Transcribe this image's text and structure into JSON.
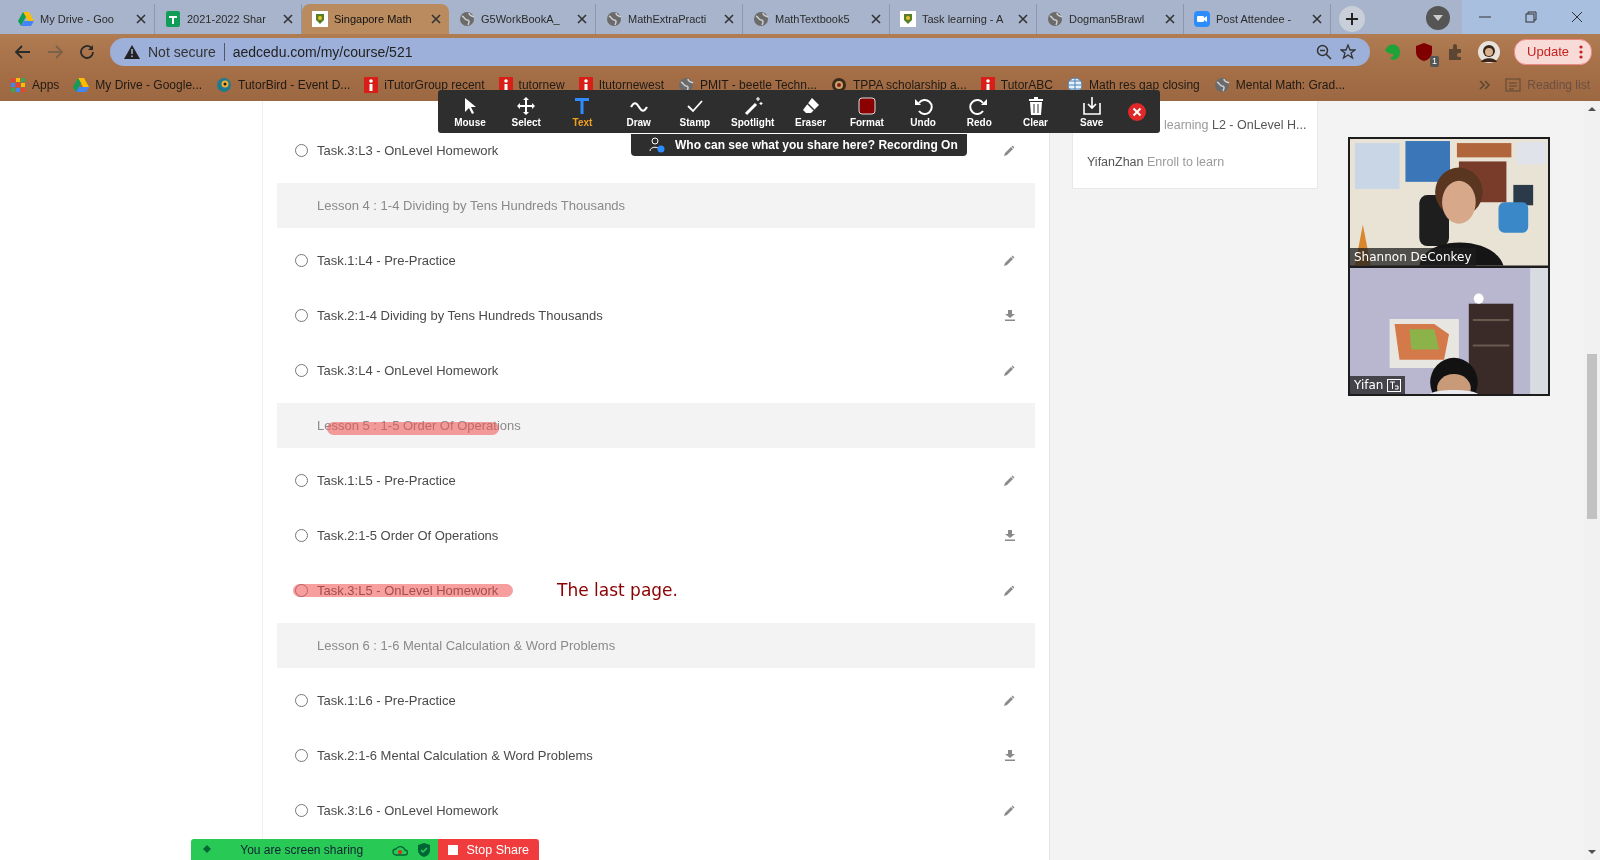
{
  "browser": {
    "tabs": [
      {
        "title": "My Drive - Goo",
        "kind": "drive",
        "selected": false
      },
      {
        "title": "2021-2022 Shar",
        "kind": "sheets",
        "selected": false
      },
      {
        "title": "Singapore Math",
        "kind": "school",
        "selected": true
      },
      {
        "title": "G5WorkBookA_",
        "kind": "globe",
        "selected": false
      },
      {
        "title": "MathExtraPracti",
        "kind": "globe",
        "selected": false
      },
      {
        "title": "MathTextbook5",
        "kind": "globe",
        "selected": false
      },
      {
        "title": "Task learning - A",
        "kind": "school",
        "selected": false
      },
      {
        "title": "Dogman5Brawl",
        "kind": "globe",
        "selected": false
      },
      {
        "title": "Post Attendee -",
        "kind": "zoom",
        "selected": false
      }
    ],
    "address_bar": {
      "security": "Not secure",
      "url": "aedcedu.com/my/course/521"
    },
    "extension_badge": "1",
    "update_button": "Update",
    "bookmarks": [
      {
        "label": "Apps",
        "kind": "apps"
      },
      {
        "label": "My Drive - Google...",
        "kind": "drive"
      },
      {
        "label": "TutorBird - Event D...",
        "kind": "bird"
      },
      {
        "label": "iTutorGroup recent",
        "kind": "info"
      },
      {
        "label": "tutornew",
        "kind": "info"
      },
      {
        "label": "Itutornewest",
        "kind": "info"
      },
      {
        "label": "PMIT - beetle Techn...",
        "kind": "globe"
      },
      {
        "label": "TPPA scholarship a...",
        "kind": "seal"
      },
      {
        "label": "TutorABC",
        "kind": "info"
      },
      {
        "label": "Math res gap closing",
        "kind": "world"
      },
      {
        "label": "Mental Math: Grad...",
        "kind": "globe"
      }
    ],
    "reading_list": "Reading list"
  },
  "annotation_toolbar": {
    "tools": [
      {
        "label": "Mouse",
        "kind": "mouse",
        "selected": false
      },
      {
        "label": "Select",
        "kind": "move",
        "selected": false
      },
      {
        "label": "Text",
        "kind": "text",
        "selected": true
      },
      {
        "label": "Draw",
        "kind": "wave",
        "selected": false
      },
      {
        "label": "Stamp",
        "kind": "check",
        "selected": false
      },
      {
        "label": "Spotlight",
        "kind": "wand",
        "selected": false
      },
      {
        "label": "Eraser",
        "kind": "eraser",
        "selected": false
      },
      {
        "label": "Format",
        "kind": "swatch",
        "selected": false
      },
      {
        "label": "Undo",
        "kind": "undo",
        "selected": false
      },
      {
        "label": "Redo",
        "kind": "redo",
        "selected": false
      },
      {
        "label": "Clear",
        "kind": "trash",
        "selected": false
      },
      {
        "label": "Save",
        "kind": "save",
        "selected": false
      }
    ],
    "tooltip": "Who can see what you share here? Recording On"
  },
  "course": {
    "rows": [
      {
        "kind": "edit-task",
        "title": "Task.3:L3 - OnLevel Homework",
        "checked": false,
        "highlighted": false
      },
      {
        "kind": "lesson",
        "title": "Lesson 4 : 1-4 Dividing by Tens Hundreds Thousands",
        "highlighted": false
      },
      {
        "kind": "edit-task",
        "title": "Task.1:L4 - Pre-Practice",
        "checked": false,
        "highlighted": false
      },
      {
        "kind": "download-task",
        "title": "Task.2:1-4 Dividing by Tens Hundreds Thousands",
        "checked": false,
        "highlighted": false
      },
      {
        "kind": "edit-task",
        "title": "Task.3:L4 - OnLevel Homework",
        "checked": false,
        "highlighted": false
      },
      {
        "kind": "lesson",
        "title": "Lesson 5 : 1-5 Order Of Operations",
        "highlighted": true
      },
      {
        "kind": "edit-task",
        "title": "Task.1:L5 - Pre-Practice",
        "checked": false,
        "highlighted": false
      },
      {
        "kind": "download-task",
        "title": "Task.2:1-5 Order Of Operations",
        "checked": false,
        "highlighted": false
      },
      {
        "kind": "edit-task",
        "title": "Task.3:L5 - OnLevel Homework",
        "checked": false,
        "highlighted": true,
        "note": "The last page."
      },
      {
        "kind": "lesson",
        "title": "Lesson 6 : 1-6 Mental Calculation & Word Problems",
        "highlighted": false
      },
      {
        "kind": "edit-task",
        "title": "Task.1:L6 - Pre-Practice",
        "checked": false,
        "highlighted": false
      },
      {
        "kind": "download-task",
        "title": "Task.2:1-6 Mental Calculation & Word Problems",
        "checked": false,
        "highlighted": false
      },
      {
        "kind": "edit-task",
        "title": "Task.3:L6 - OnLevel Homework",
        "checked": false,
        "highlighted": false
      }
    ]
  },
  "activity": [
    {
      "action": "learning",
      "target": "L2 - OnLevel H..."
    },
    {
      "user": "YifanZhan",
      "action": "Enroll to learn"
    }
  ],
  "video_panel": {
    "participants": [
      {
        "name": "Shannon DeConkey",
        "kind": "teacher",
        "show_icon": false
      },
      {
        "name": "Yifan",
        "kind": "student",
        "show_icon": true
      }
    ]
  },
  "share_bar": {
    "status": "You are screen sharing",
    "stop_button": "Stop Share"
  }
}
